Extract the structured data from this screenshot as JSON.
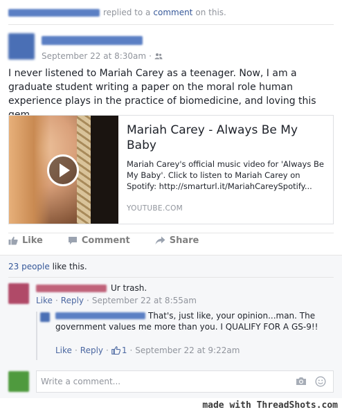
{
  "activity": {
    "actor_redacted": true,
    "text_before": "replied to a",
    "link": "comment",
    "text_after": "on this."
  },
  "post": {
    "author_redacted": true,
    "timestamp": "September 22 at 8:30am",
    "separator": "·",
    "audience_icon": "friends-icon",
    "text": "I never listened to Mariah Carey as a teenager. Now, I am a graduate student writing a paper on the moral role human experience plays in the practice of biomedicine, and loving this gem."
  },
  "link_card": {
    "title": "Mariah Carey - Always Be My Baby",
    "description": "Mariah Carey's official music video for 'Always Be My Baby'. Click to listen to Mariah Carey on Spotify: http://smarturl.it/MariahCareySpotify...",
    "domain": "YOUTUBE.COM",
    "play_icon": "play-icon"
  },
  "actions": {
    "like": "Like",
    "comment": "Comment",
    "share": "Share"
  },
  "likes": {
    "count_link": "23 people",
    "suffix": "like this."
  },
  "comments": [
    {
      "author_redacted": true,
      "text": "Ur trash.",
      "like": "Like",
      "reply": "Reply",
      "timestamp": "September 22 at 8:55am"
    },
    {
      "author_redacted": true,
      "text": "That's, just like, your opinion...man. The government values me more than you. I QUALIFY FOR A GS-9!!",
      "like": "Like",
      "reply": "Reply",
      "like_count": "1",
      "timestamp": "September 22 at 9:22am"
    }
  ],
  "composer": {
    "placeholder": "Write a comment...",
    "camera_icon": "camera-icon",
    "emoji_icon": "smiley-icon"
  },
  "watermark": "made with ThreadShots.com",
  "colors": {
    "link": "#365899",
    "meta": "#90949c",
    "comment_bg": "#f6f7f9"
  }
}
